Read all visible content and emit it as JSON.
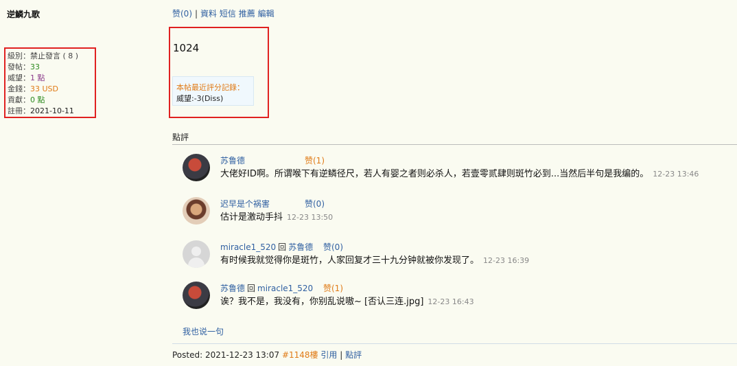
{
  "user": {
    "name": "逆鱗九歌",
    "stats": [
      {
        "label": "級別：",
        "value": "禁止發言 ( 8 )",
        "color": "#444"
      },
      {
        "label": "發帖：",
        "value": "33",
        "color": "#2d8a1f"
      },
      {
        "label": "威望：",
        "value": "1 點",
        "color": "#8a3a8a"
      },
      {
        "label": "金錢：",
        "value": "33 USD",
        "color": "#e07b17"
      },
      {
        "label": "貢獻：",
        "value": "0 點",
        "color": "#2d8a1f"
      },
      {
        "label": "註冊：",
        "value": "2021-10-11",
        "color": "#222"
      }
    ]
  },
  "post_links": {
    "like": "赞(0)",
    "profile": "資料",
    "message": "短信",
    "recommend": "推薦",
    "edit": "編輯",
    "separator": "|"
  },
  "post": {
    "body": "1024",
    "rating_title": "本帖最近評分記錄：",
    "rating_line": "威望:-3(Diss)"
  },
  "comments_title": "點評",
  "comments": [
    {
      "author": "苏鲁德",
      "reply_word": "",
      "reply_to": "",
      "likes": "赞(1)",
      "likes_highlight": true,
      "text": "大佬好ID啊。所谓喉下有逆鳞径尺，若人有婴之者则必杀人，若壹零贰肆则斑竹必到...当然后半句是我编的。",
      "time": "12-23 13:46",
      "avatar": "dark"
    },
    {
      "author": "迟早是个祸害",
      "reply_word": "",
      "reply_to": "",
      "likes": "赞(0)",
      "likes_highlight": false,
      "text": "估计是激动手抖",
      "time": "12-23 13:50",
      "avatar": "girl"
    },
    {
      "author": "miracle1_520",
      "reply_word": "回",
      "reply_to": "苏鲁德",
      "likes": "赞(0)",
      "likes_highlight": false,
      "text": "有时候我就觉得你是斑竹，人家回复才三十九分钟就被你发现了。",
      "time": "12-23 16:39",
      "avatar": "default"
    },
    {
      "author": "苏鲁德",
      "reply_word": "回",
      "reply_to": "miracle1_520",
      "likes": "赞(1)",
      "likes_highlight": true,
      "text": "诶？我不是，我没有，你别乱说嗷~ [否认三连.jpg]",
      "time": "12-23 16:43",
      "avatar": "dark"
    }
  ],
  "say_something": "我也说一句",
  "footer": {
    "posted_label": "Posted:",
    "posted_time": "2021-12-23 13:07",
    "floor": "#1148樓",
    "quote": "引用",
    "comment": "點評",
    "separator": "|"
  },
  "colors": {
    "background": "#fafbf1",
    "link": "#2f5fa1",
    "highlight_box": "#e02020",
    "orange": "#e07b17"
  }
}
